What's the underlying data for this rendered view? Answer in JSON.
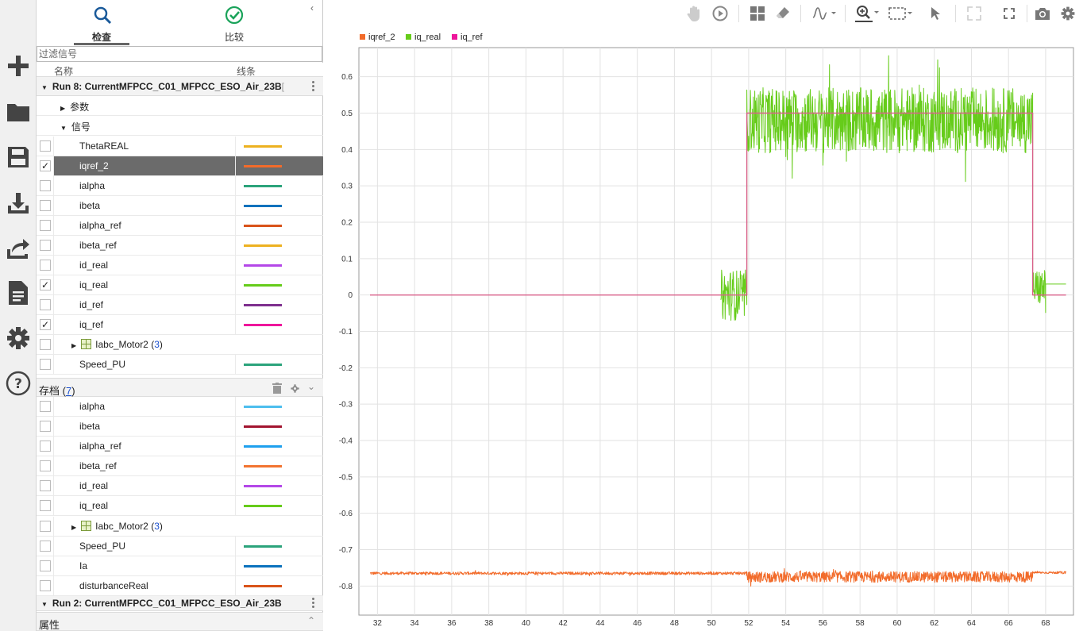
{
  "tabs": [
    {
      "label": "检查"
    },
    {
      "label": "比较"
    }
  ],
  "filter_placeholder": "过滤信号",
  "columns": {
    "name": "名称",
    "line": "线条"
  },
  "run8": {
    "title": "Run 8: CurrentMFPCC_C01_MFPCC_ESO_Air_23B",
    "title_tail": "[",
    "params": "参数",
    "signals": "信号"
  },
  "run8_signals": [
    {
      "name": "ThetaREAL",
      "checked": false,
      "color": "#edb120"
    },
    {
      "name": "iqref_2",
      "checked": true,
      "color": "#f26b2a",
      "selected": true
    },
    {
      "name": "ialpha",
      "checked": false,
      "color": "#2ba37b"
    },
    {
      "name": "ibeta",
      "checked": false,
      "color": "#0b72bd"
    },
    {
      "name": "ialpha_ref",
      "checked": false,
      "color": "#d95319"
    },
    {
      "name": "ibeta_ref",
      "checked": false,
      "color": "#edb120"
    },
    {
      "name": "id_real",
      "checked": false,
      "color": "#b447e8"
    },
    {
      "name": "iq_real",
      "checked": true,
      "color": "#66cc1a"
    },
    {
      "name": "id_ref",
      "checked": false,
      "color": "#7e2f8e"
    },
    {
      "name": "iq_ref",
      "checked": true,
      "color": "#ee169b"
    }
  ],
  "run8_group": {
    "name": "Iabc_Motor2",
    "count": "3"
  },
  "run8_after": [
    {
      "name": "Speed_PU",
      "color": "#2ba37b"
    }
  ],
  "archive": {
    "label": "存档",
    "count": "7"
  },
  "archive_signals": [
    {
      "name": "ialpha",
      "color": "#4dbeee"
    },
    {
      "name": "ibeta",
      "color": "#a2142f"
    },
    {
      "name": "ialpha_ref",
      "color": "#1ea0ee"
    },
    {
      "name": "ibeta_ref",
      "color": "#f27430"
    },
    {
      "name": "id_real",
      "color": "#b447e8"
    },
    {
      "name": "iq_real",
      "color": "#66cc1a"
    }
  ],
  "archive_group": {
    "name": "Iabc_Motor2",
    "count": "3"
  },
  "archive_after": [
    {
      "name": "Speed_PU",
      "color": "#2ba37b"
    },
    {
      "name": "Ia",
      "color": "#0b72bd"
    },
    {
      "name": "disturbanceReal",
      "color": "#d95319"
    }
  ],
  "run2": {
    "title": "Run 2: CurrentMFPCC_C01_MFPCC_ESO_Air_23B"
  },
  "properties": {
    "label": "属性"
  },
  "legend": [
    {
      "name": "iqref_2",
      "color": "#f26b2a"
    },
    {
      "name": "iq_real",
      "color": "#66cc1a"
    },
    {
      "name": "iq_ref",
      "color": "#ee169b"
    }
  ],
  "chart_data": {
    "type": "line",
    "xlim": [
      31,
      69.5
    ],
    "ylim": [
      -0.88,
      0.68
    ],
    "xticks": [
      32,
      34,
      36,
      38,
      40,
      42,
      44,
      46,
      48,
      50,
      52,
      54,
      56,
      58,
      60,
      62,
      64,
      66,
      68
    ],
    "yticks": [
      0.6,
      0.5,
      0.4,
      0.3,
      0.2,
      0.1,
      0,
      -0.1,
      -0.2,
      -0.3,
      -0.4,
      -0.5,
      -0.6,
      -0.7,
      -0.8
    ],
    "grid": true,
    "series": [
      {
        "name": "iq_ref",
        "color": "#d9608a",
        "points": [
          [
            31.6,
            0
          ],
          [
            51.9,
            0
          ],
          [
            51.9,
            0.5
          ],
          [
            67.3,
            0.5
          ],
          [
            67.3,
            0
          ],
          [
            69.1,
            0
          ]
        ]
      },
      {
        "name": "iq_real",
        "color": "#66cc1a",
        "segments": [
          {
            "x0": 50.5,
            "x1": 51.9,
            "mean": 0,
            "band": 0.07
          },
          {
            "x0": 51.9,
            "x1": 67.3,
            "mean": 0.48,
            "band": 0.09
          },
          {
            "x0": 67.3,
            "x1": 68.0,
            "mean": 0.02,
            "band": 0.05
          },
          {
            "x0": 68.0,
            "x1": 69.1,
            "mean": 0.03,
            "band": 0
          }
        ]
      },
      {
        "name": "iqref_2",
        "color": "#f26b2a",
        "segments": [
          {
            "x0": 31.6,
            "x1": 51.9,
            "mean": -0.765,
            "band": 0.004
          },
          {
            "x0": 51.9,
            "x1": 67.3,
            "mean": -0.775,
            "band": 0.015
          },
          {
            "x0": 67.3,
            "x1": 69.1,
            "mean": -0.763,
            "band": 0.003
          }
        ]
      }
    ]
  }
}
